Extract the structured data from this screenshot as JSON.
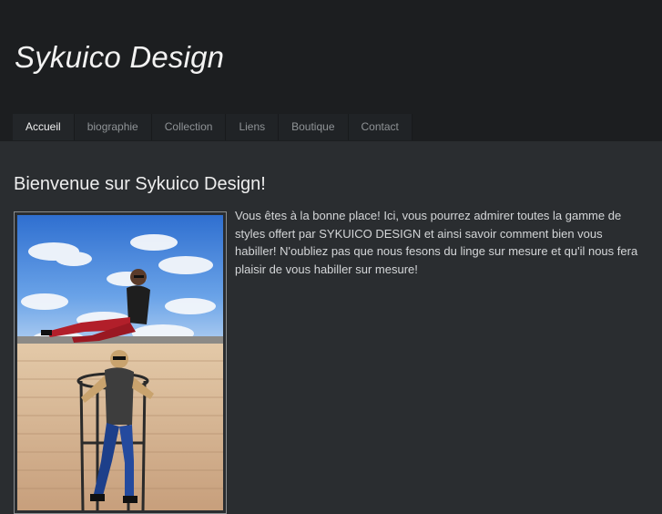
{
  "site": {
    "title": "Sykuico Design"
  },
  "nav": {
    "items": [
      {
        "label": "Accueil",
        "active": true
      },
      {
        "label": "biographie",
        "active": false
      },
      {
        "label": "Collection",
        "active": false
      },
      {
        "label": "Liens",
        "active": false
      },
      {
        "label": "Boutique",
        "active": false
      },
      {
        "label": "Contact",
        "active": false
      }
    ]
  },
  "main": {
    "heading": "Bienvenue sur Sykuico Design!",
    "intro": "Vous êtes à la bonne place! Ici, vous pourrez admirer toutes la gamme de styles offert par SYKUICO DESIGN et ainsi savoir comment bien vous habiller! N'oubliez pas que nous fesons du linge sur mesure et qu'il nous fera plaisir de vous habiller sur mesure!",
    "photo": {
      "subject": "two-women-fashion-photo"
    }
  },
  "colors": {
    "header_bg": "#1c1e20",
    "page_bg": "#2a2d30",
    "nav_bg": "#202326",
    "text": "#d4d6d8",
    "heading": "#eeeeee"
  }
}
